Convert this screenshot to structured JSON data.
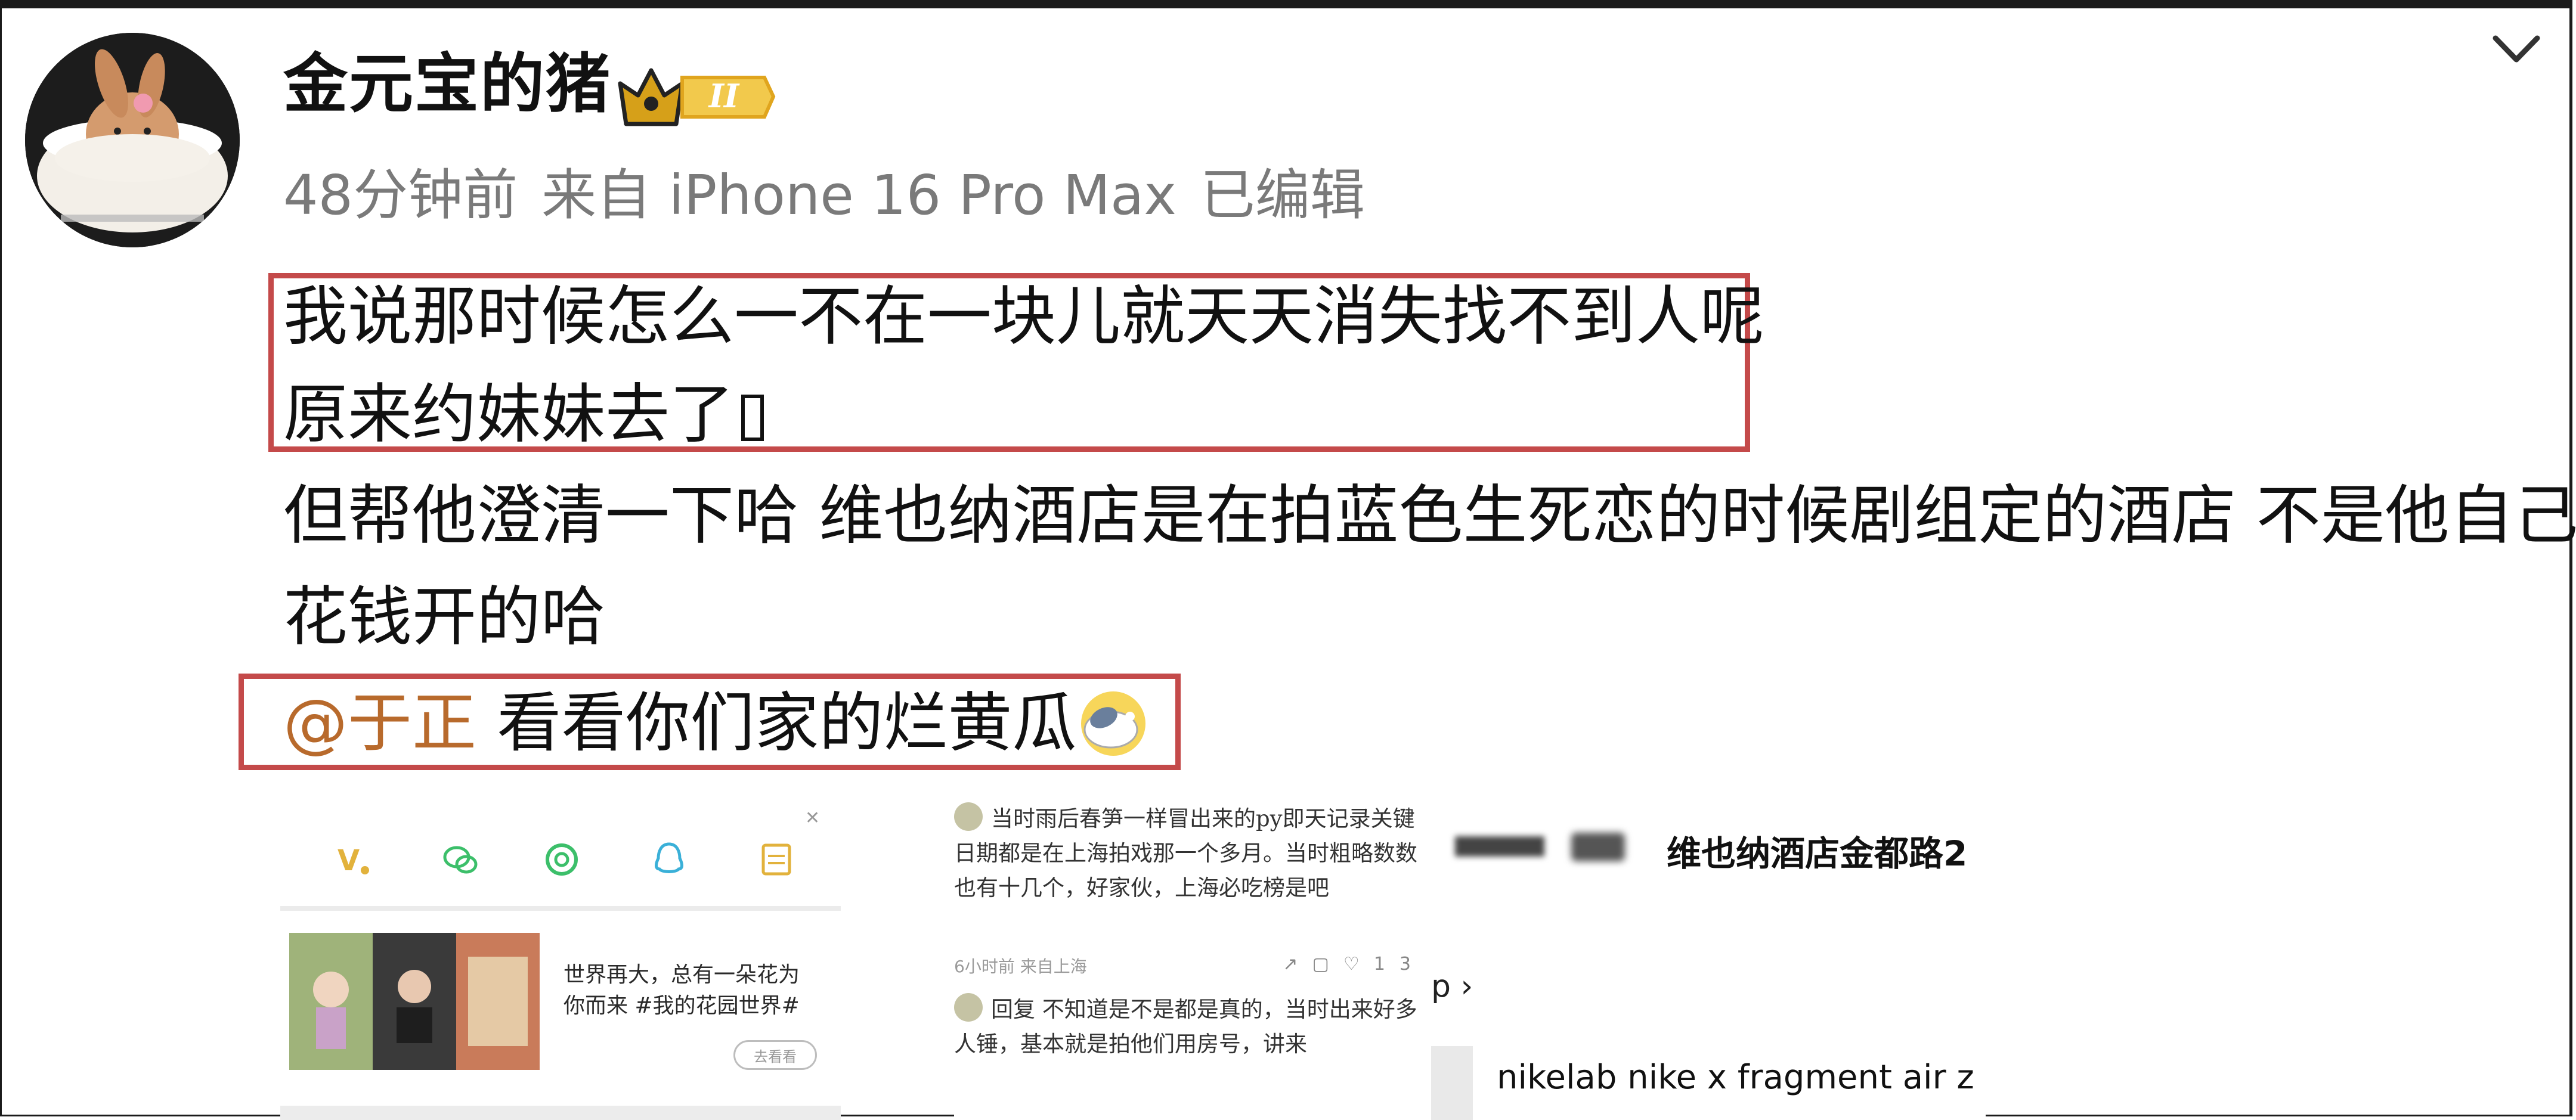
{
  "post": {
    "username": "金元宝的猪",
    "badge_level": "II",
    "meta": {
      "time": "48分钟前",
      "source": "来自 iPhone 16 Pro Max",
      "edited": "已编辑"
    },
    "lines": [
      "我说那时候怎么一不在一块儿就天天消失找不到人呢",
      "原来约妹妹去了",
      "但帮他澄清一下哈 维也纳酒店是在拍蓝色生死恋的时候剧组定的酒店 不是他自己",
      "花钱开的哈"
    ],
    "mention": "@于正",
    "mention_tail": " 看看你们家的烂黄瓜",
    "highlight_color": "#c44a4a",
    "mention_color": "#b86a2c"
  },
  "thumbs": {
    "t1": {
      "text": "世界再大，总有一朵花为你而来 #我的花园世界#",
      "button": "去看看",
      "close": "✕"
    },
    "t2": {
      "comment1": "当时雨后春笋一样冒出来的py即天记录关键日期都是在上海拍戏那一个多月。当时粗略数数也有十几个，好家伙，上海必吃榜是吧",
      "comment1_meta": "6小时前 来自上海",
      "comment1_likes": "13",
      "comment2": "回复 不知道是不是都是真的，当时出来好多人锤，基本就是拍他们用房号，讲来"
    },
    "t3": {
      "title": "维也纳酒店金都路2",
      "link": "p ›",
      "item": "nikelab nike x fragment air z"
    }
  }
}
